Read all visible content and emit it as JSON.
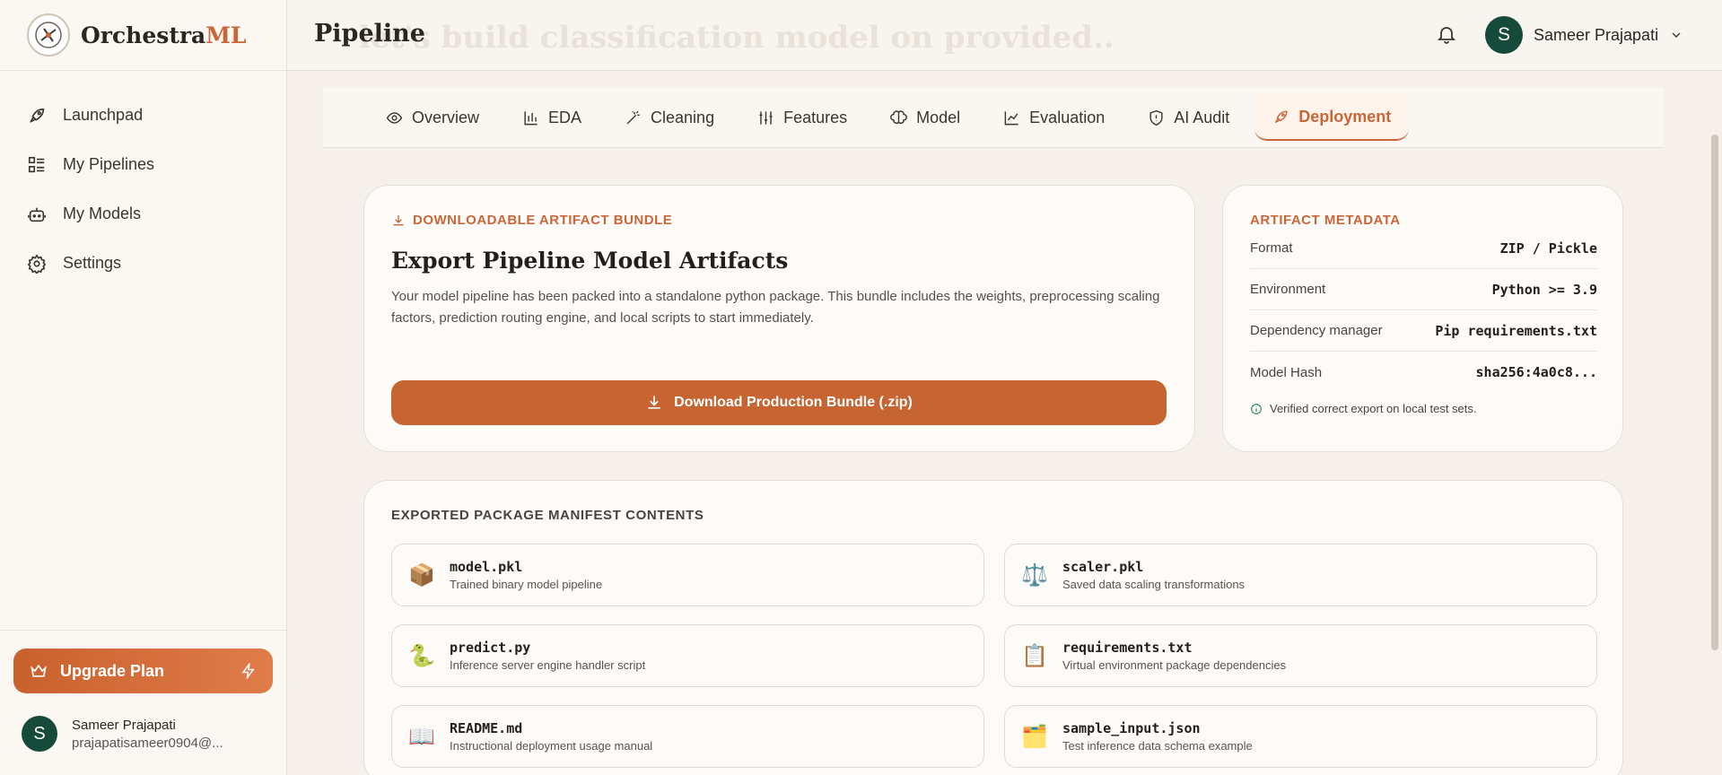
{
  "brand": {
    "name_main": "Orchestra",
    "name_accent": "ML"
  },
  "sidebar": {
    "items": [
      {
        "label": "Launchpad",
        "icon": "rocket-icon"
      },
      {
        "label": "My Pipelines",
        "icon": "list-icon"
      },
      {
        "label": "My Models",
        "icon": "robot-icon"
      },
      {
        "label": "Settings",
        "icon": "gear-icon"
      }
    ],
    "upgrade_label": "Upgrade Plan",
    "user": {
      "initial": "S",
      "name": "Sameer Prajapati",
      "email": "prajapatisameer0904@..."
    }
  },
  "header": {
    "title": "Pipeline",
    "background_text": "let's build classification model on provided..",
    "user": {
      "initial": "S",
      "name": "Sameer Prajapati"
    }
  },
  "tabs": [
    {
      "label": "Overview",
      "icon": "eye-icon",
      "active": false
    },
    {
      "label": "EDA",
      "icon": "bar-chart-icon",
      "active": false
    },
    {
      "label": "Cleaning",
      "icon": "wand-icon",
      "active": false
    },
    {
      "label": "Features",
      "icon": "sliders-icon",
      "active": false
    },
    {
      "label": "Model",
      "icon": "brain-icon",
      "active": false
    },
    {
      "label": "Evaluation",
      "icon": "line-chart-icon",
      "active": false
    },
    {
      "label": "AI Audit",
      "icon": "shield-icon",
      "active": false
    },
    {
      "label": "Deployment",
      "icon": "rocket-icon",
      "active": true
    }
  ],
  "export": {
    "kicker": "DOWNLOADABLE ARTIFACT BUNDLE",
    "title": "Export Pipeline Model Artifacts",
    "description": "Your model pipeline has been packed into a standalone python package. This bundle includes the weights, preprocessing scaling factors, prediction routing engine, and local scripts to start immediately.",
    "button_label": "Download Production Bundle (.zip)"
  },
  "metadata": {
    "heading": "ARTIFACT METADATA",
    "rows": [
      {
        "key": "Format",
        "value": "ZIP / Pickle"
      },
      {
        "key": "Environment",
        "value": "Python >= 3.9"
      },
      {
        "key": "Dependency manager",
        "value": "Pip requirements.txt"
      },
      {
        "key": "Model Hash",
        "value": "sha256:4a0c8..."
      }
    ],
    "verified_note": "Verified correct export on local test sets."
  },
  "manifest": {
    "heading": "EXPORTED PACKAGE MANIFEST CONTENTS",
    "files": [
      {
        "name": "model.pkl",
        "desc": "Trained binary model pipeline",
        "icon": "package-icon",
        "glyph": "📦"
      },
      {
        "name": "scaler.pkl",
        "desc": "Saved data scaling transformations",
        "icon": "scales-icon",
        "glyph": "⚖️"
      },
      {
        "name": "predict.py",
        "desc": "Inference server engine handler script",
        "icon": "python-icon",
        "glyph": "🐍"
      },
      {
        "name": "requirements.txt",
        "desc": "Virtual environment package dependencies",
        "icon": "clipboard-icon",
        "glyph": "📋"
      },
      {
        "name": "README.md",
        "desc": "Instructional deployment usage manual",
        "icon": "book-icon",
        "glyph": "📖"
      },
      {
        "name": "sample_input.json",
        "desc": "Test inference data schema example",
        "icon": "folder-icon",
        "glyph": "🗂️"
      }
    ]
  },
  "colors": {
    "accent": "#c9673a",
    "avatar": "#164a3a",
    "background": "#f5f1ea"
  }
}
